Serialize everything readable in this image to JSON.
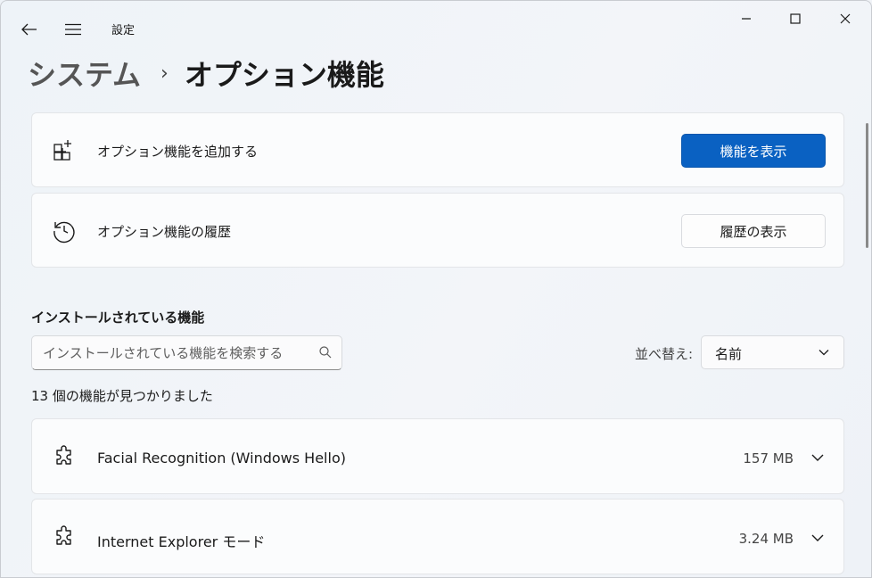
{
  "app": {
    "title": "設定"
  },
  "breadcrumb": {
    "parent": "システム",
    "separator": "›",
    "current": "オプション機能"
  },
  "actions": {
    "add": {
      "label": "オプション機能を追加する",
      "button": "機能を表示",
      "icon": "add-apps-icon"
    },
    "history": {
      "label": "オプション機能の履歴",
      "button": "履歴の表示",
      "icon": "history-icon"
    }
  },
  "installed": {
    "title": "インストールされている機能",
    "search_placeholder": "インストールされている機能を検索する",
    "sort_label": "並べ替え:",
    "sort_value": "名前",
    "count_text": "13 個の機能が見つかりました",
    "features": [
      {
        "name": "Facial Recognition (Windows Hello)",
        "size": "157 MB",
        "icon": "puzzle-icon"
      },
      {
        "name": "Internet Explorer モード",
        "size": "3.24 MB",
        "icon": "puzzle-icon"
      }
    ]
  },
  "colors": {
    "accent": "#0a61c2",
    "background": "#f0f3f7",
    "card": "#fbfcfd"
  }
}
